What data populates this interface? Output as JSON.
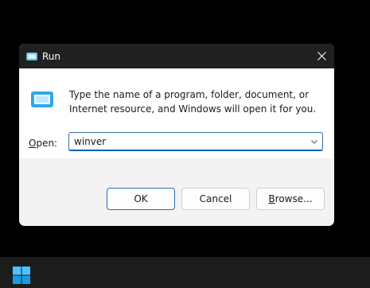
{
  "dialog": {
    "title": "Run",
    "close_icon": "close-icon",
    "description": "Type the name of a program, folder, document, or Internet resource, and Windows will open it for you.",
    "open_label_access": "O",
    "open_label_rest": "pen:",
    "open_value": "winver",
    "ok_label": "OK",
    "cancel_label": "Cancel",
    "browse_access": "B",
    "browse_rest": "rowse..."
  },
  "taskbar": {
    "start_icon": "windows-start-icon"
  },
  "colors": {
    "accent": "#005fb8",
    "titlebar": "#202020",
    "dialog_bg": "#f3f3f3",
    "content_bg": "#ffffff",
    "taskbar": "#1c1c1c"
  }
}
